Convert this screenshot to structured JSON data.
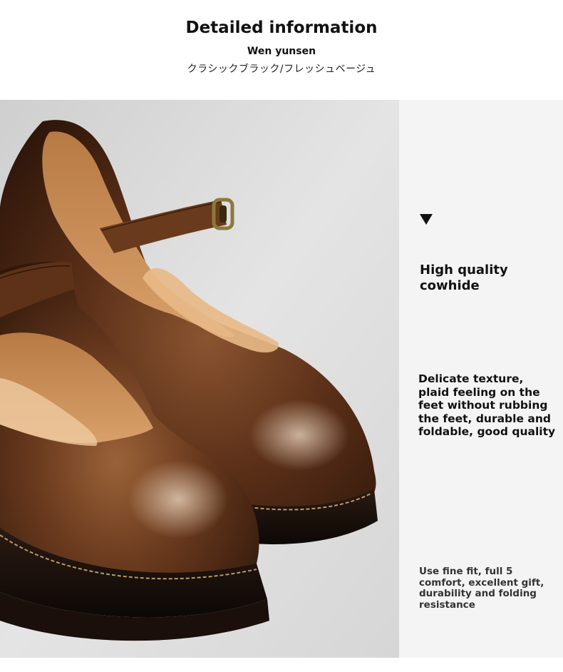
{
  "header": {
    "title": "Detailed information",
    "brand": "Wen yunsen",
    "colors_jp": "クラシックブラック/フレッシュベージュ"
  },
  "photo": {
    "subject": "brown-leather-mary-jane-shoes"
  },
  "features": {
    "arrow_icon": "triangle-down-icon",
    "f1": "High quality cowhide",
    "f2": "Delicate texture, plaid feeling on the feet without rubbing the feet, durable and foldable, good quality",
    "f3": "Use fine fit, full 5 comfort, excellent gift, durability and folding resistance"
  },
  "colors": {
    "leather": "#6b3a20",
    "panel": "#f4f4f4",
    "text": "#111111"
  }
}
